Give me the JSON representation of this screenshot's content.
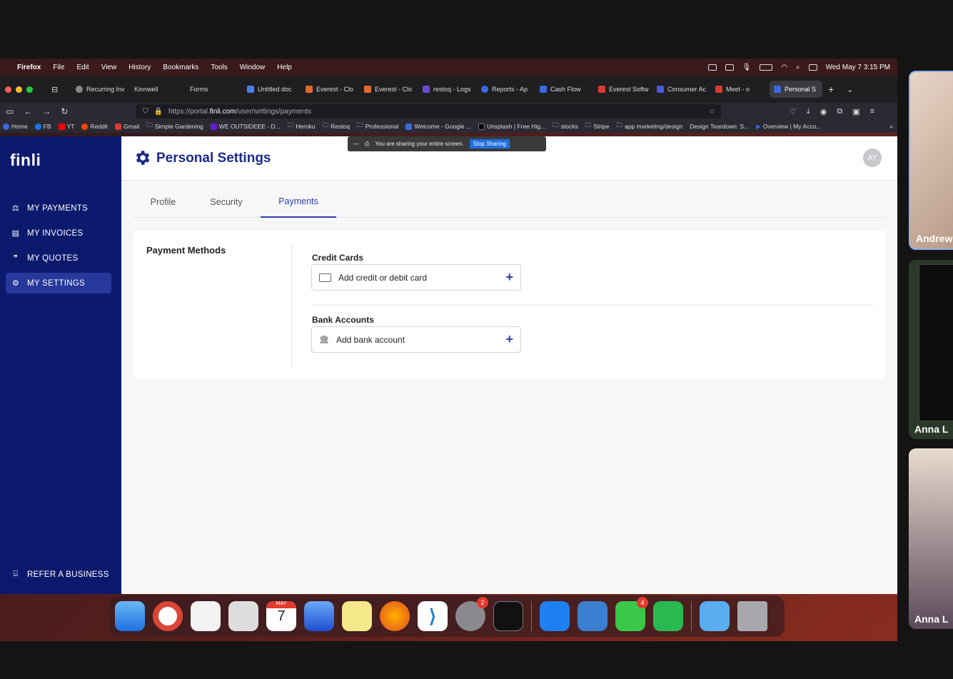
{
  "menubar": {
    "app": "Firefox",
    "items": [
      "File",
      "Edit",
      "View",
      "History",
      "Bookmarks",
      "Tools",
      "Window",
      "Help"
    ],
    "clock": "Wed May 7  3:15 PM"
  },
  "browser_tabs": [
    {
      "label": "Recurring Inv"
    },
    {
      "label": "Kinnwell"
    },
    {
      "label": "Forms"
    },
    {
      "label": "Untitled doc"
    },
    {
      "label": "Everest - Clo"
    },
    {
      "label": "Everest - Clo"
    },
    {
      "label": "restoq - Logs"
    },
    {
      "label": "Reports - Ap"
    },
    {
      "label": "Cash Flow"
    },
    {
      "label": "Everest Softw"
    },
    {
      "label": "Consumer Ac"
    },
    {
      "label": "Meet - o"
    },
    {
      "label": "Personal S"
    }
  ],
  "url": {
    "prefix": "https://portal.",
    "host": "finli.com",
    "path": "/user/settings/payments"
  },
  "bookmarks": [
    "Home",
    "FB",
    "YT",
    "Reddit",
    "Gmail",
    "Simple Gardening",
    "WE OUTSIDEEE - D...",
    "Heroku",
    "Restoq",
    "Professional",
    "Welcome - Google ...",
    "Unsplash | Free Hig...",
    "stocks",
    "Stripe",
    "app marketing/design",
    "Design Teardown: S...",
    "Overview | My Acco..."
  ],
  "share_banner": {
    "text": "You are sharing your entire screen.",
    "button": "Stop Sharing"
  },
  "sidebar": {
    "logo": "finli",
    "items": [
      {
        "label": "MY PAYMENTS"
      },
      {
        "label": "MY INVOICES"
      },
      {
        "label": "MY QUOTES"
      },
      {
        "label": "MY SETTINGS"
      }
    ],
    "footer": "REFER A BUSINESS"
  },
  "header": {
    "title": "Personal Settings",
    "avatar": "AY"
  },
  "tabs": [
    "Profile",
    "Security",
    "Payments"
  ],
  "payment_methods": {
    "heading": "Payment Methods",
    "credit_heading": "Credit Cards",
    "credit_button": "Add credit or debit card",
    "bank_heading": "Bank Accounts",
    "bank_button": "Add bank account"
  },
  "dock": {
    "calendar_month": "MAY",
    "calendar_day": "7",
    "settings_badge": "2",
    "messages_badge": "4"
  },
  "participants": [
    "Andrew",
    "Anna L",
    "Anna L"
  ],
  "colors": {
    "brand_navy": "#0c1a6e",
    "accent_blue": "#2b3fb0"
  }
}
